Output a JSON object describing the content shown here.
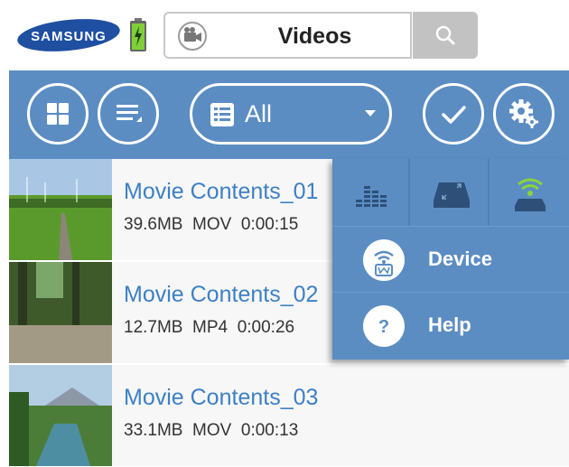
{
  "header": {
    "brand": "SAMSUNG",
    "title": "Videos",
    "battery_icon": "battery-charging-icon",
    "title_icon": "video-camera-icon",
    "search_icon": "search-icon"
  },
  "toolbar": {
    "grid_icon": "grid-view-icon",
    "sort_icon": "sort-list-icon",
    "filter": {
      "selected": "All",
      "icon": "list-icon"
    },
    "select_icon": "check-icon",
    "settings_icon": "settings-gear-icon"
  },
  "colors": {
    "accent": "#5b8dc3",
    "link": "#3d80c5",
    "search_bg": "#c2c2c2"
  },
  "videos": [
    {
      "name": "Movie Contents_01",
      "size": "39.6MB",
      "format": "MOV",
      "duration": "0:00:15"
    },
    {
      "name": "Movie Contents_02",
      "size": "12.7MB",
      "format": "MP4",
      "duration": "0:00:26"
    },
    {
      "name": "Movie Contents_03",
      "size": "33.1MB",
      "format": "MOV",
      "duration": "0:00:13"
    }
  ],
  "popup": {
    "tabs": [
      "equalizer-icon",
      "screen-mirror-icon",
      "wifi-router-icon"
    ],
    "items": [
      {
        "label": "Device",
        "icon": "wifi-device-icon"
      },
      {
        "label": "Help",
        "icon": "question-icon"
      }
    ]
  }
}
